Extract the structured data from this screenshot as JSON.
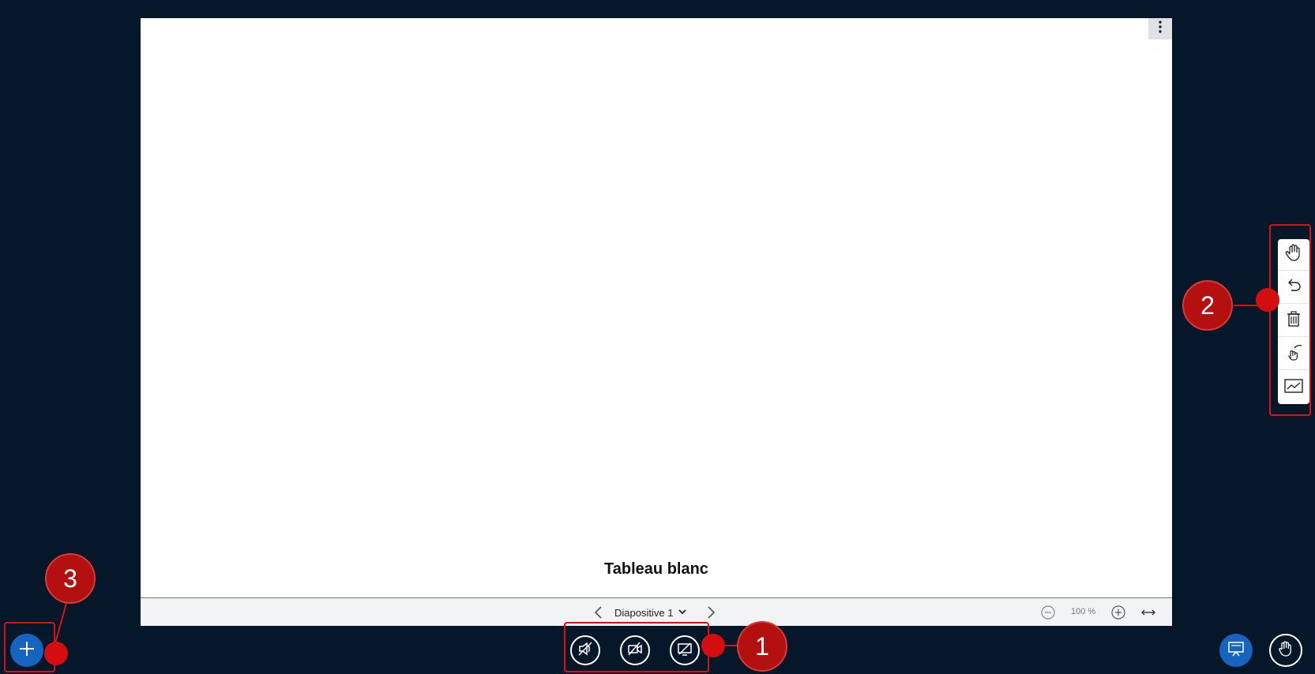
{
  "slide": {
    "title": "Tableau blanc",
    "menu_icon": "more-vertical-icon"
  },
  "footer": {
    "slide_label": "Diapositive 1",
    "zoom_level": "100 %"
  },
  "media_controls": {
    "icons": [
      "speaker-icon",
      "camera-off-icon",
      "screen-share-off-icon"
    ]
  },
  "whiteboard_tools": {
    "icons": [
      "hand-pan-icon",
      "undo-icon",
      "trash-icon",
      "multi-user-pointer-icon",
      "line-chart-icon"
    ]
  },
  "callouts": {
    "c1": "1",
    "c2": "2",
    "c3": "3"
  },
  "colors": {
    "background": "#06172a",
    "accent_blue": "#1565c0",
    "callout_red": "#d41414",
    "white": "#ffffff"
  }
}
